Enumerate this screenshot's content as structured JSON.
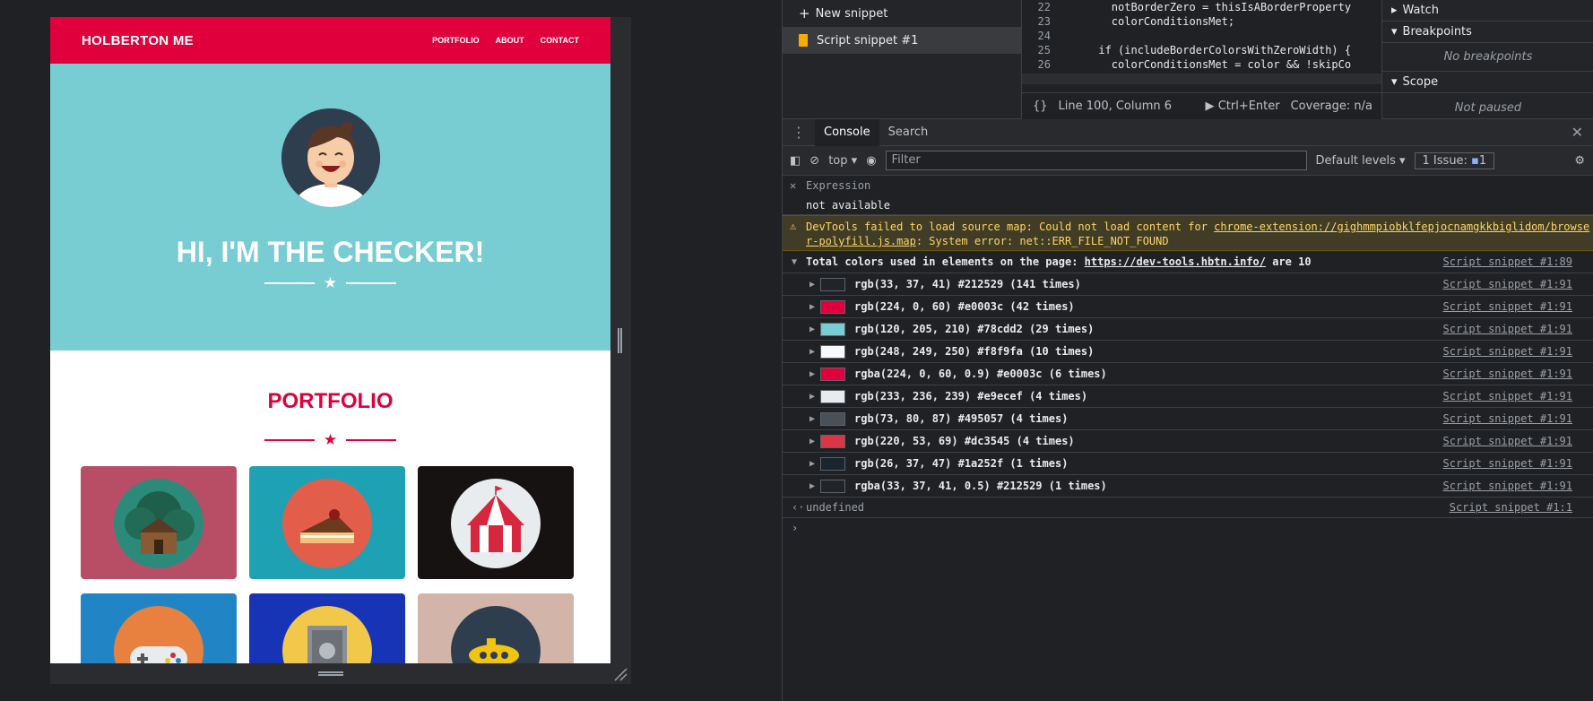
{
  "site": {
    "brand": "HOLBERTON ME",
    "nav": [
      "PORTFOLIO",
      "ABOUT",
      "CONTACT"
    ],
    "hero_title": "HI, I'M THE CHECKER!",
    "portfolio_title": "PORTFOLIO"
  },
  "devtools": {
    "new_snippet": "New snippet",
    "snippet_name": "Script snippet #1",
    "code_lines": [
      {
        "n": "22",
        "t": "        notBorderZero = thisIsABorderProperty"
      },
      {
        "n": "23",
        "t": "        colorConditionsMet;"
      },
      {
        "n": "24",
        "t": ""
      },
      {
        "n": "25",
        "t": "      if (includeBorderColorsWithZeroWidth) {"
      },
      {
        "n": "26",
        "t": "        colorConditionsMet = color && !skipCo"
      }
    ],
    "editor_status": {
      "pos": "Line 100, Column 6",
      "run": "Ctrl+Enter",
      "coverage": "Coverage: n/a"
    },
    "debug": {
      "watch": "Watch",
      "breakpoints": "Breakpoints",
      "no_breakpoints": "No breakpoints",
      "scope": "Scope",
      "not_paused": "Not paused"
    },
    "tabs": [
      "Console",
      "Search"
    ],
    "toolbar": {
      "context": "top",
      "filter_placeholder": "Filter",
      "levels": "Default levels",
      "issues": "1 Issue:",
      "issue_count": "1"
    },
    "console": {
      "expression_label": "Expression",
      "expression_value": "not available",
      "warning_text": "DevTools failed to load source map: Could not load content for",
      "warning_link": "chrome-extension://gighmmpiobklfepjocnamgkkbiglidom/browser-polyfill.js.map",
      "warning_tail": ": System error: net::ERR_FILE_NOT_FOUND",
      "total_prefix": "Total colors used in elements on the page:",
      "total_link": "https://dev-tools.hbtn.info/",
      "total_suffix": "are 10",
      "total_src": "Script snippet #1:89",
      "colors": [
        {
          "label": "rgb(33, 37, 41) #212529 (141 times)",
          "hex": "#212529"
        },
        {
          "label": "rgb(224, 0, 60) #e0003c (42 times)",
          "hex": "#e0003c"
        },
        {
          "label": "rgb(120, 205, 210) #78cdd2 (29 times)",
          "hex": "#78cdd2"
        },
        {
          "label": "rgb(248, 249, 250) #f8f9fa (10 times)",
          "hex": "#f8f9fa"
        },
        {
          "label": "rgba(224, 0, 60, 0.9) #e0003c (6 times)",
          "hex": "#e0003c"
        },
        {
          "label": "rgb(233, 236, 239) #e9ecef (4 times)",
          "hex": "#e9ecef"
        },
        {
          "label": "rgb(73, 80, 87) #495057 (4 times)",
          "hex": "#495057"
        },
        {
          "label": "rgb(220, 53, 69) #dc3545 (4 times)",
          "hex": "#dc3545"
        },
        {
          "label": "rgb(26, 37, 47) #1a252f (1 times)",
          "hex": "#1a252f"
        },
        {
          "label": "rgba(33, 37, 41, 0.5) #212529 (1 times)",
          "hex": "#212529"
        }
      ],
      "color_src": "Script snippet #1:91",
      "result": "undefined",
      "result_src": "Script snippet #1:1"
    }
  }
}
